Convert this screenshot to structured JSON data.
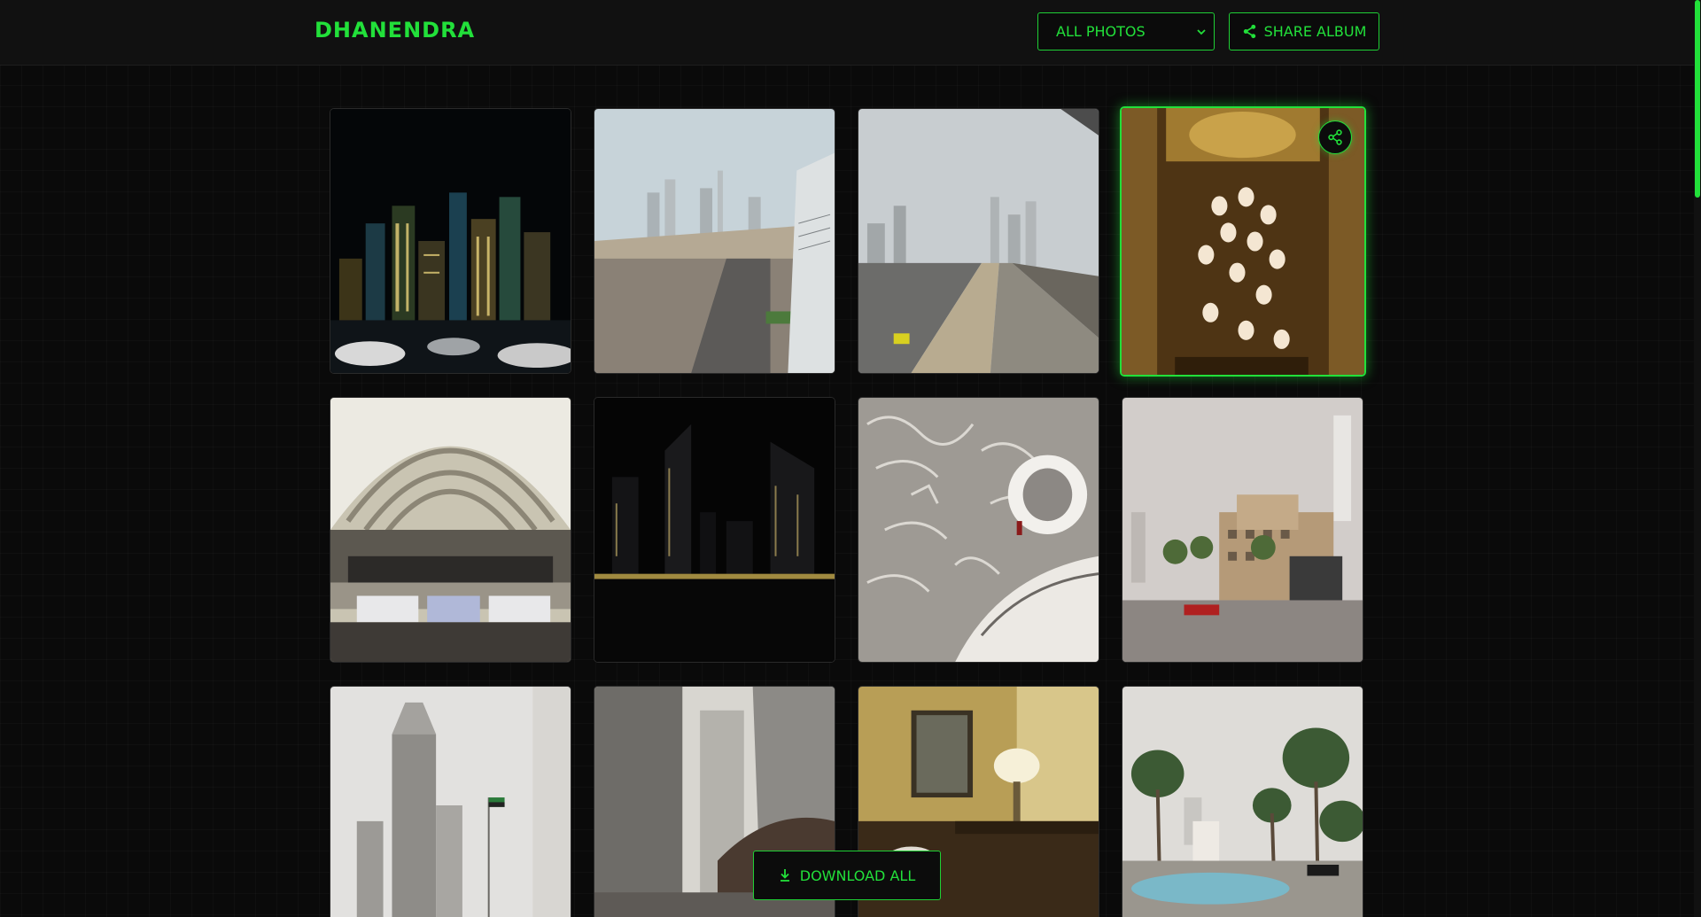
{
  "header": {
    "brand": "DHANENDRA",
    "filter": {
      "selected": "ALL PHOTOS",
      "icon": "chevron-down-icon"
    },
    "share_album_label": "SHARE ALBUM",
    "share_icon": "share-icon"
  },
  "gallery": {
    "selected_index": 3,
    "photos": [
      {
        "scene": "marina-night-skyline"
      },
      {
        "scene": "highway-overpass-skyline"
      },
      {
        "scene": "sheikh-zayed-road-metro"
      },
      {
        "scene": "hotel-atrium-chandeliers"
      },
      {
        "scene": "mall-arched-roof-interior"
      },
      {
        "scene": "towers-night-reflection"
      },
      {
        "scene": "calligraphy-atrium-stairs"
      },
      {
        "scene": "souk-buildings-plaza"
      },
      {
        "scene": "downtown-towers-flag"
      },
      {
        "scene": "tower-and-opera-building"
      },
      {
        "scene": "hotel-room-mirror-lamp"
      },
      {
        "scene": "palm-trees-fountain"
      }
    ]
  },
  "actions": {
    "download_all_label": "DOWNLOAD ALL",
    "download_icon": "download-icon"
  },
  "colors": {
    "accent": "#22e03a",
    "background": "#0a0a0a",
    "header": "#111111"
  }
}
